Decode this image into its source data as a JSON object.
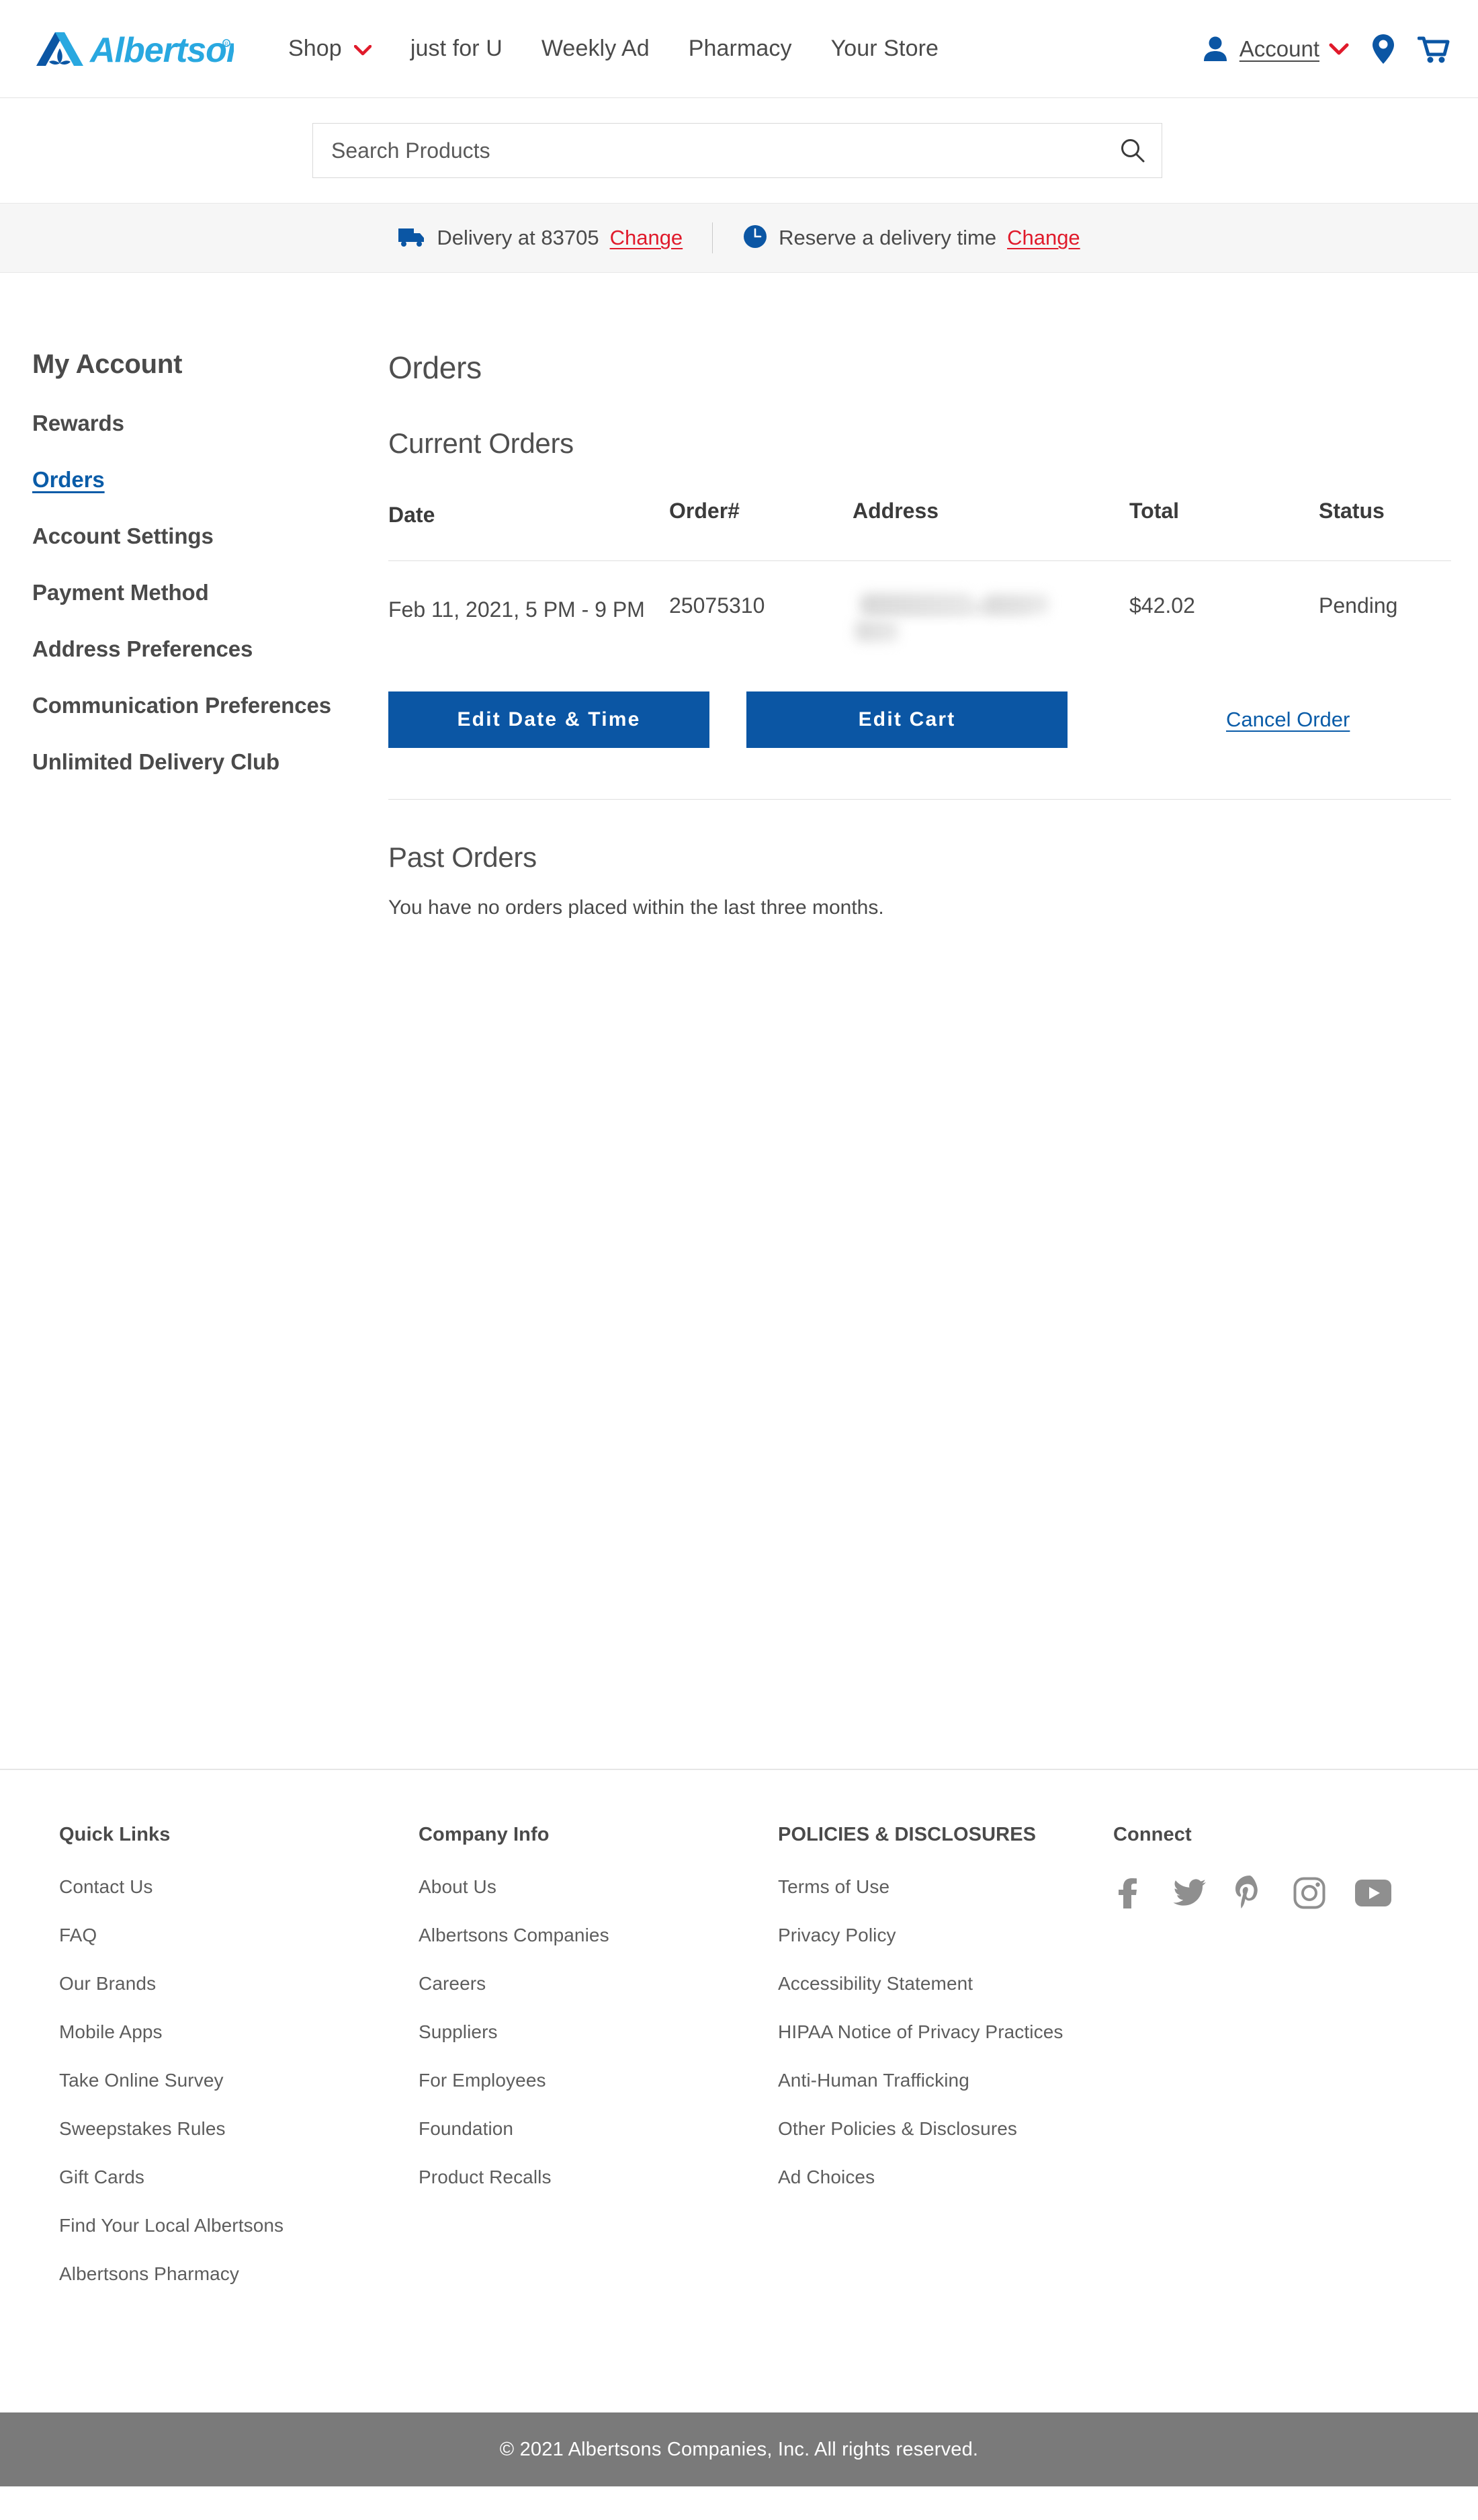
{
  "header": {
    "logo_text": "Albertsons",
    "logo_name": "albertsons-logo",
    "nav": [
      {
        "label": "Shop",
        "has_chevron": true
      },
      {
        "label": "just for U",
        "has_chevron": false
      },
      {
        "label": "Weekly Ad",
        "has_chevron": false
      },
      {
        "label": "Pharmacy",
        "has_chevron": false
      },
      {
        "label": "Your Store",
        "has_chevron": false
      }
    ],
    "account_label": "Account",
    "icons": {
      "account": "account-person-icon",
      "chevron": "chevron-down-icon",
      "location": "location-pin-icon",
      "cart": "shopping-cart-icon"
    }
  },
  "search": {
    "placeholder": "Search Products",
    "value": "",
    "icon": "search-icon"
  },
  "delivery_bar": {
    "delivery_icon": "delivery-truck-icon",
    "delivery_text": "Delivery at 83705",
    "delivery_change": "Change",
    "time_icon": "clock-icon",
    "time_text": "Reserve a delivery time",
    "time_change": "Change"
  },
  "sidebar": {
    "title": "My Account",
    "items": [
      {
        "label": "Rewards",
        "active": false
      },
      {
        "label": "Orders",
        "active": true
      },
      {
        "label": "Account Settings",
        "active": false
      },
      {
        "label": "Payment Method",
        "active": false
      },
      {
        "label": "Address Preferences",
        "active": false
      },
      {
        "label": "Communication Preferences",
        "active": false
      },
      {
        "label": "Unlimited Delivery Club",
        "active": false
      }
    ]
  },
  "main": {
    "page_title": "Orders",
    "current_orders_title": "Current Orders",
    "columns": [
      "Date",
      "Order#",
      "Address",
      "Total",
      "Status"
    ],
    "orders": [
      {
        "date": "Feb 11, 2021, 5 PM - 9 PM",
        "order_number": "25075310",
        "address": "",
        "address_redacted": true,
        "total": "$42.02",
        "status": "Pending"
      }
    ],
    "actions": {
      "edit_date_time": "Edit Date & Time",
      "edit_cart": "Edit Cart",
      "cancel_order": "Cancel Order"
    },
    "past_orders_title": "Past Orders",
    "past_orders_empty": "You have no orders placed within the last three months."
  },
  "footer": {
    "columns": [
      {
        "heading": "Quick Links",
        "links": [
          "Contact Us",
          "FAQ",
          "Our Brands",
          "Mobile Apps",
          "Take Online Survey",
          "Sweepstakes Rules",
          "Gift Cards",
          "Find Your Local Albertsons",
          "Albertsons Pharmacy"
        ]
      },
      {
        "heading": "Company Info",
        "links": [
          "About Us",
          "Albertsons Companies",
          "Careers",
          "Suppliers",
          "For Employees",
          "Foundation",
          "Product Recalls"
        ]
      },
      {
        "heading": "POLICIES & DISCLOSURES",
        "links": [
          "Terms of Use",
          "Privacy Policy",
          "Accessibility Statement",
          "HIPAA Notice of Privacy Practices",
          "Anti-Human Trafficking",
          "Other Policies & Disclosures",
          "Ad Choices"
        ]
      }
    ],
    "connect_heading": "Connect",
    "socials": [
      "facebook-icon",
      "twitter-icon",
      "pinterest-icon",
      "instagram-icon",
      "youtube-icon"
    ],
    "copyright": "© 2021 Albertsons Companies, Inc.  All rights reserved."
  },
  "colors": {
    "brand_blue_dark": "#0b56a4",
    "brand_blue_light": "#29a8e0",
    "link_blue": "#0a5ca8",
    "change_red": "#e01a2b",
    "text_grey": "#4a4a4a",
    "footer_grey": "#7a7a7a"
  }
}
